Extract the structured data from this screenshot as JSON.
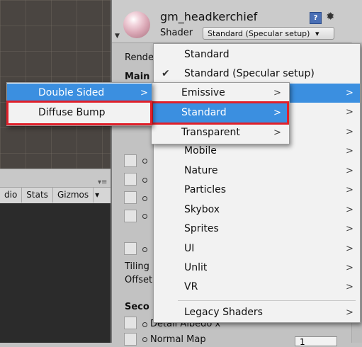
{
  "scene_toolbar": {
    "items": [
      "dio",
      "Stats",
      "Gizmos"
    ],
    "dropdown_arrow": "▾"
  },
  "inspector": {
    "material_name": "gm_headkerchief",
    "shader_label": "Shader",
    "shader_value": "Standard (Specular setup)",
    "shader_arrow": "▾",
    "help_icon": "?",
    "gear_icon": "✹",
    "rendering_label_partial": "Rende",
    "main_label_partial": "Main",
    "tiling_label": "Tiling",
    "offset_label": "Offset",
    "secondary_label_partial": "Seco",
    "detail_albedo_partial": "Detail Albedo x",
    "normal_map_partial": "Normal Map",
    "normal_map_value": "1"
  },
  "menu_main": {
    "items": [
      {
        "label": "Standard",
        "checked": false,
        "submenu": false
      },
      {
        "label": "Standard (Specular setup)",
        "checked": true,
        "submenu": false
      },
      {
        "label": "",
        "checked": false,
        "submenu": true
      },
      {
        "label": "",
        "checked": false,
        "submenu": true
      },
      {
        "label": "",
        "checked": false,
        "submenu": true
      },
      {
        "label": "Mobile",
        "checked": false,
        "submenu": true
      },
      {
        "label": "Nature",
        "checked": false,
        "submenu": true
      },
      {
        "label": "Particles",
        "checked": false,
        "submenu": true
      },
      {
        "label": "Skybox",
        "checked": false,
        "submenu": true
      },
      {
        "label": "Sprites",
        "checked": false,
        "submenu": true
      },
      {
        "label": "UI",
        "checked": false,
        "submenu": true
      },
      {
        "label": "Unlit",
        "checked": false,
        "submenu": true
      },
      {
        "label": "VR",
        "checked": false,
        "submenu": true
      },
      {
        "label": "Legacy Shaders",
        "checked": false,
        "submenu": true
      }
    ],
    "check_glyph": "✔",
    "arrow_glyph": ">"
  },
  "menu_sub": {
    "items": [
      "Emissive",
      "Standard",
      "Transparent"
    ],
    "highlighted": "Standard"
  },
  "menu_sub2": {
    "items": [
      "Double Sided",
      "Diffuse Bump"
    ],
    "highlighted": "Double Sided",
    "outlined": "Diffuse Bump"
  }
}
